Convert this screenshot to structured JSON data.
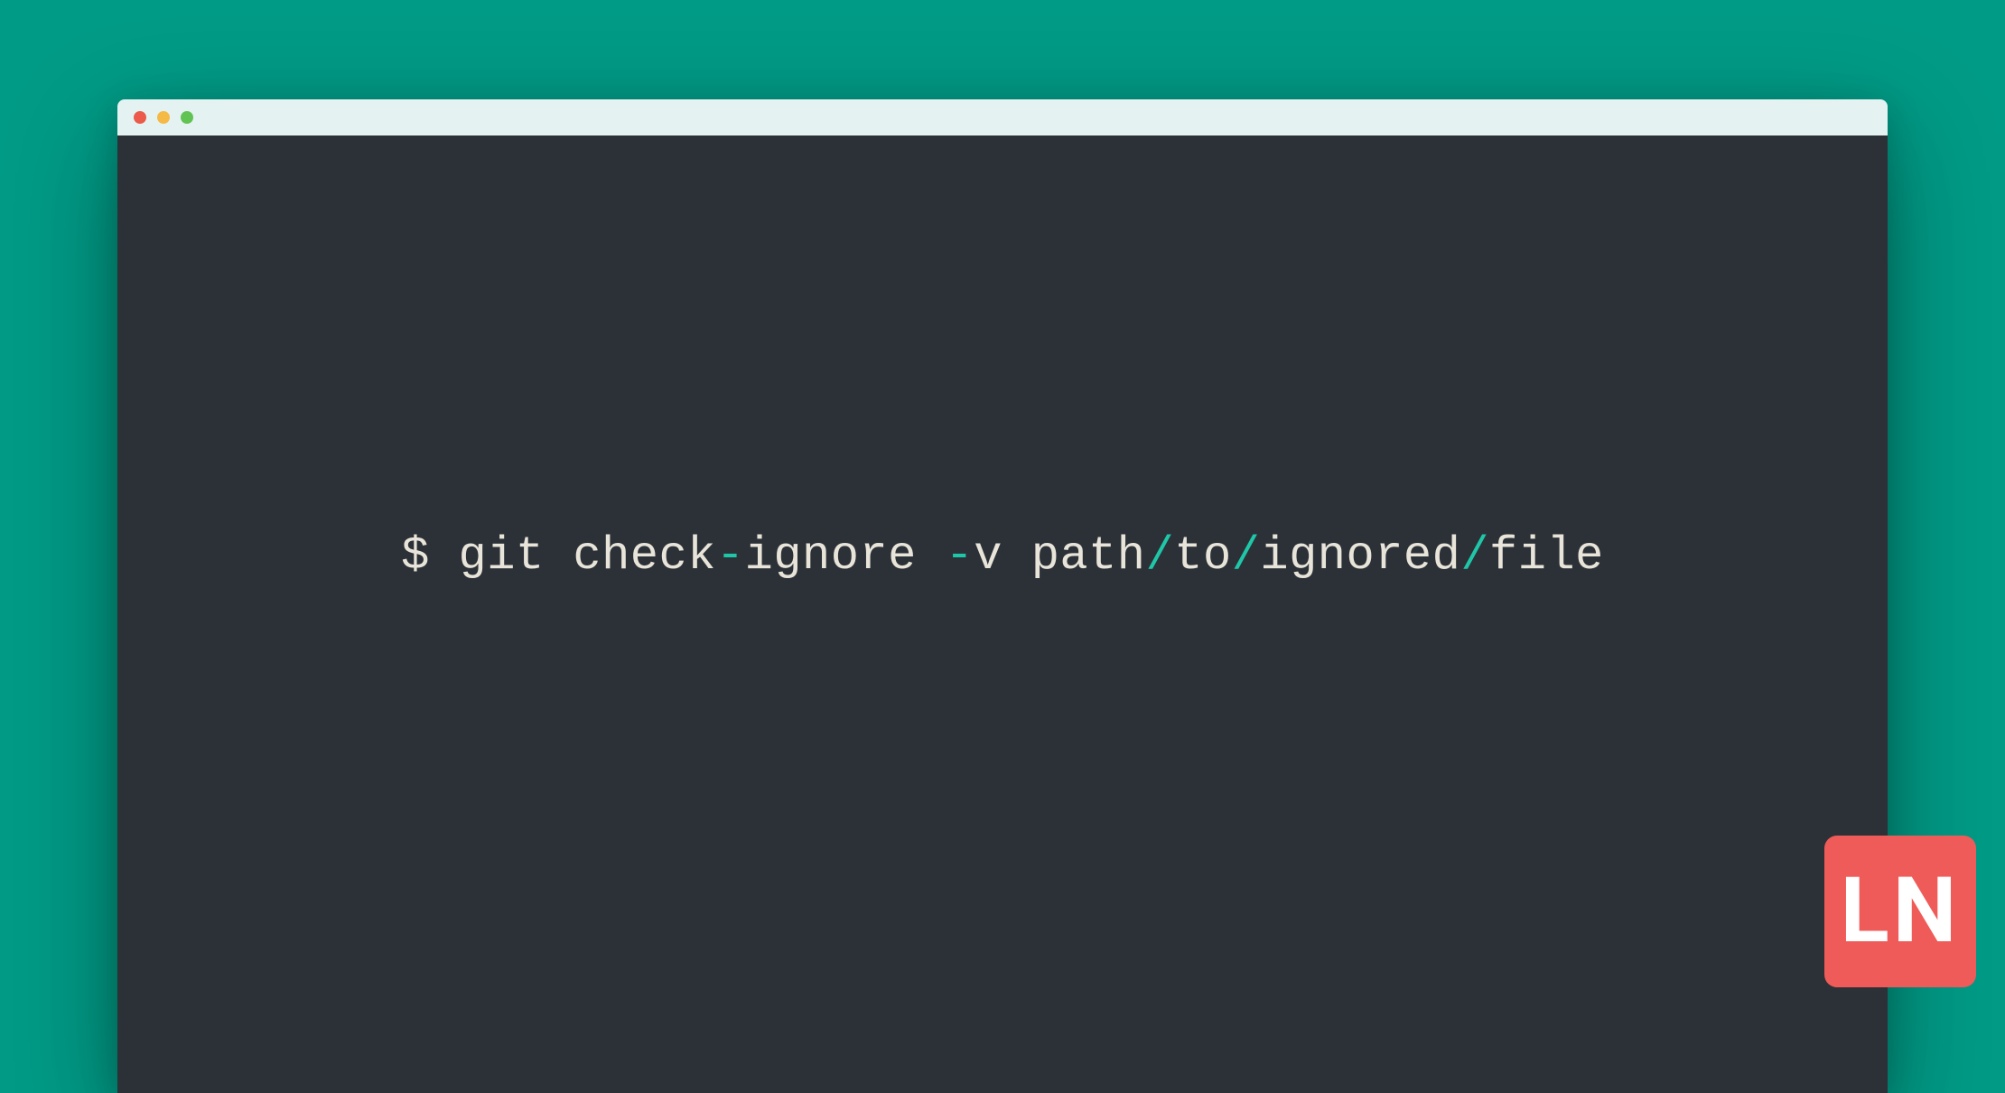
{
  "terminal": {
    "segments": [
      {
        "text": "$ git check",
        "accent": false
      },
      {
        "text": "-",
        "accent": true
      },
      {
        "text": "ignore ",
        "accent": false
      },
      {
        "text": "-",
        "accent": true
      },
      {
        "text": "v path",
        "accent": false
      },
      {
        "text": "/",
        "accent": true
      },
      {
        "text": "to",
        "accent": false
      },
      {
        "text": "/",
        "accent": true
      },
      {
        "text": "ignored",
        "accent": false
      },
      {
        "text": "/",
        "accent": true
      },
      {
        "text": "file",
        "accent": false
      }
    ]
  },
  "logo": {
    "text": "LN"
  },
  "colors": {
    "background": "#009b86",
    "terminal_bg": "#2b3137",
    "titlebar_bg": "#e4f3f1",
    "text": "#e8e4d9",
    "accent": "#1fc7a8",
    "logo_bg": "#ef5b58"
  }
}
